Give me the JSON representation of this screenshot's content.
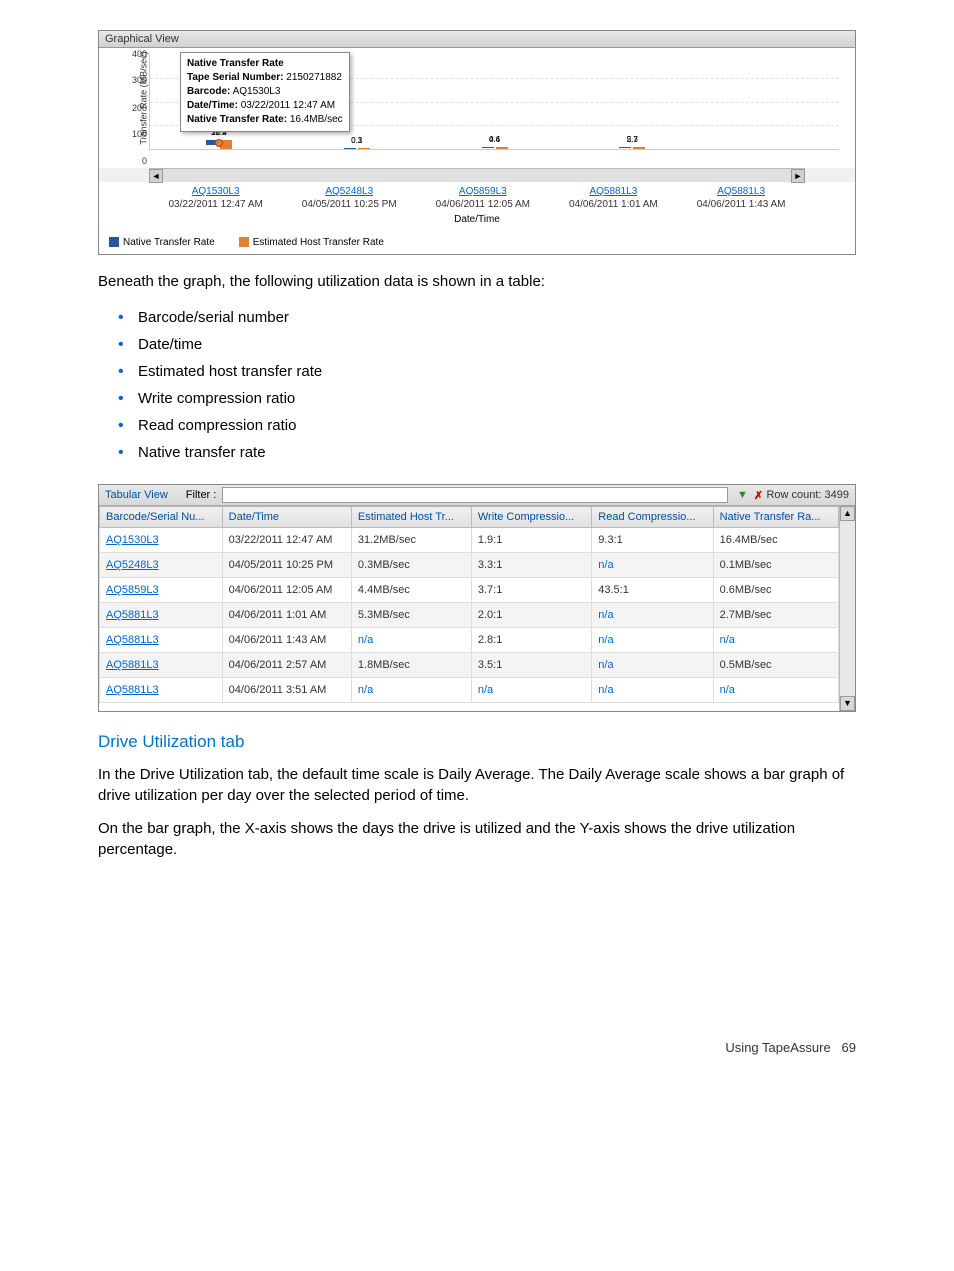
{
  "chart_panel": {
    "title": "Graphical View",
    "ylabel": "Transfer Rate (MB/sec)",
    "xlabel": "Date/Time",
    "legend": {
      "native": "Native Transfer Rate",
      "estimated": "Estimated Host Transfer Rate"
    },
    "tooltip": {
      "title": "Native Transfer Rate",
      "serial_label": "Tape Serial Number:",
      "serial": "2150271882",
      "barcode_label": "Barcode:",
      "barcode": "AQ1530L3",
      "datetime_label": "Date/Time:",
      "datetime": "03/22/2011 12:47 AM",
      "rate_label": "Native Transfer Rate:",
      "rate": "16.4MB/sec"
    }
  },
  "chart_data": {
    "type": "bar",
    "ylim": [
      0,
      400
    ],
    "yticks": [
      0,
      100,
      200,
      300,
      400
    ],
    "categories": [
      "AQ1530L3",
      "AQ5248L3",
      "AQ5859L3",
      "AQ5881L3",
      "AQ5881L3"
    ],
    "datetimes": [
      "03/22/2011 12:47 AM",
      "04/05/2011 10:25 PM",
      "04/06/2011 12:05 AM",
      "04/06/2011 1:01 AM",
      "04/06/2011 1:43 AM"
    ],
    "series": [
      {
        "name": "Native Transfer Rate",
        "values": [
          16.4,
          0.1,
          0.6,
          2.7,
          null
        ],
        "value_labels": [
          "16.4",
          "0.1",
          "0.6",
          "2.7",
          ""
        ]
      },
      {
        "name": "Estimated Host Transfer Rate",
        "values": [
          31.2,
          0.3,
          4.4,
          5.3,
          null
        ],
        "value_labels": [
          "31.2",
          "0.3",
          "4.4",
          "5.3",
          ""
        ]
      }
    ]
  },
  "para1": "Beneath the graph, the following utilization data is shown in a table:",
  "bullets": [
    "Barcode/serial number",
    "Date/time",
    "Estimated host transfer rate",
    "Write compression ratio",
    "Read compression ratio",
    "Native transfer rate"
  ],
  "tabular": {
    "title": "Tabular View",
    "filter_label": "Filter :",
    "row_count_label": "Row count: 3499",
    "columns": [
      "Barcode/Serial Nu...",
      "Date/Time",
      "Estimated Host Tr...",
      "Write Compressio...",
      "Read Compressio...",
      "Native Transfer Ra..."
    ],
    "rows": [
      {
        "barcode": "AQ1530L3",
        "dt": "03/22/2011 12:47 AM",
        "est": "31.2MB/sec",
        "wc": "1.9:1",
        "rc": "9.3:1",
        "nt": "16.4MB/sec"
      },
      {
        "barcode": "AQ5248L3",
        "dt": "04/05/2011 10:25 PM",
        "est": "0.3MB/sec",
        "wc": "3.3:1",
        "rc": "n/a",
        "nt": "0.1MB/sec"
      },
      {
        "barcode": "AQ5859L3",
        "dt": "04/06/2011 12:05 AM",
        "est": "4.4MB/sec",
        "wc": "3.7:1",
        "rc": "43.5:1",
        "nt": "0.6MB/sec"
      },
      {
        "barcode": "AQ5881L3",
        "dt": "04/06/2011 1:01 AM",
        "est": "5.3MB/sec",
        "wc": "2.0:1",
        "rc": "n/a",
        "nt": "2.7MB/sec"
      },
      {
        "barcode": "AQ5881L3",
        "dt": "04/06/2011 1:43 AM",
        "est": "n/a",
        "wc": "2.8:1",
        "rc": "n/a",
        "nt": "n/a"
      },
      {
        "barcode": "AQ5881L3",
        "dt": "04/06/2011 2:57 AM",
        "est": "1.8MB/sec",
        "wc": "3.5:1",
        "rc": "n/a",
        "nt": "0.5MB/sec"
      },
      {
        "barcode": "AQ5881L3",
        "dt": "04/06/2011 3:51 AM",
        "est": "n/a",
        "wc": "n/a",
        "rc": "n/a",
        "nt": "n/a"
      }
    ]
  },
  "section_heading": "Drive Utilization tab",
  "para2": "In the Drive Utilization tab, the default time scale is Daily Average. The Daily Average scale shows a bar graph of drive utilization per day over the selected period of time.",
  "para3": "On the bar graph, the X-axis shows the days the drive is utilized and the Y-axis shows the drive utilization percentage.",
  "footer": {
    "text": "Using TapeAssure",
    "page": "69"
  }
}
